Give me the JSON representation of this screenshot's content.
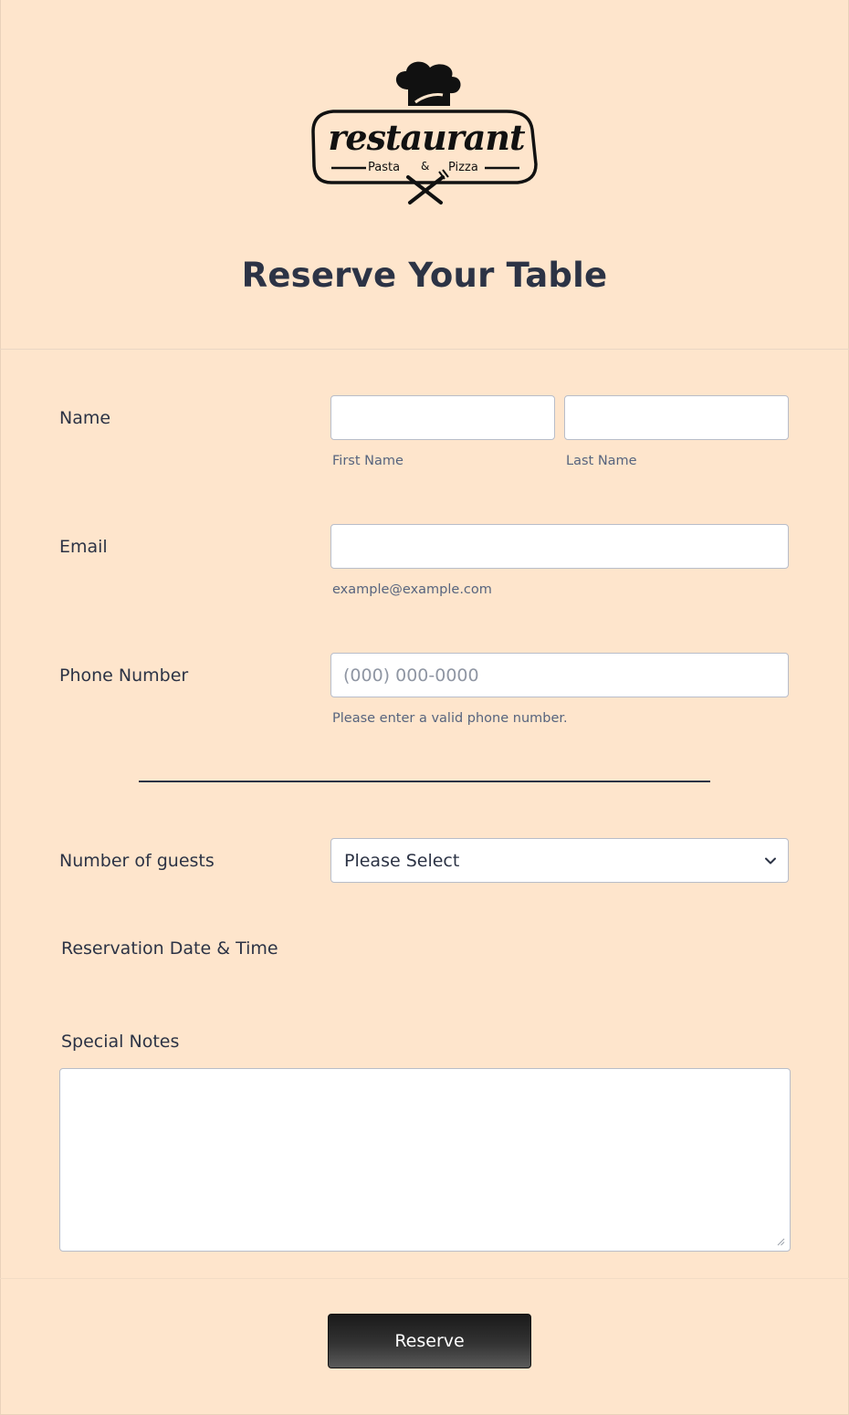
{
  "logo": {
    "wordmark": "restaurant",
    "left_text": "Pasta",
    "ampersand": "&",
    "right_text": "Pizza"
  },
  "header": {
    "title": "Reserve Your Table"
  },
  "fields": {
    "name": {
      "label": "Name",
      "first_sublabel": "First Name",
      "last_sublabel": "Last Name",
      "first_value": "",
      "last_value": ""
    },
    "email": {
      "label": "Email",
      "sublabel": "example@example.com",
      "value": ""
    },
    "phone": {
      "label": "Phone Number",
      "placeholder": "(000) 000-0000",
      "sublabel": "Please enter a valid phone number.",
      "value": ""
    },
    "guests": {
      "label": "Number of guests",
      "selected": "Please Select"
    },
    "datetime": {
      "label": "Reservation Date & Time"
    },
    "notes": {
      "label": "Special Notes",
      "value": ""
    }
  },
  "submit": {
    "label": "Reserve"
  },
  "colors": {
    "background": "#fee5cc",
    "text": "#2c3345",
    "input_border": "#b8bdc9",
    "button": "#2a2a2a"
  },
  "icons": {
    "logo": "restaurant-chef-hat-logo",
    "select": "chevron-down-icon",
    "resize": "resize-grip-icon"
  }
}
